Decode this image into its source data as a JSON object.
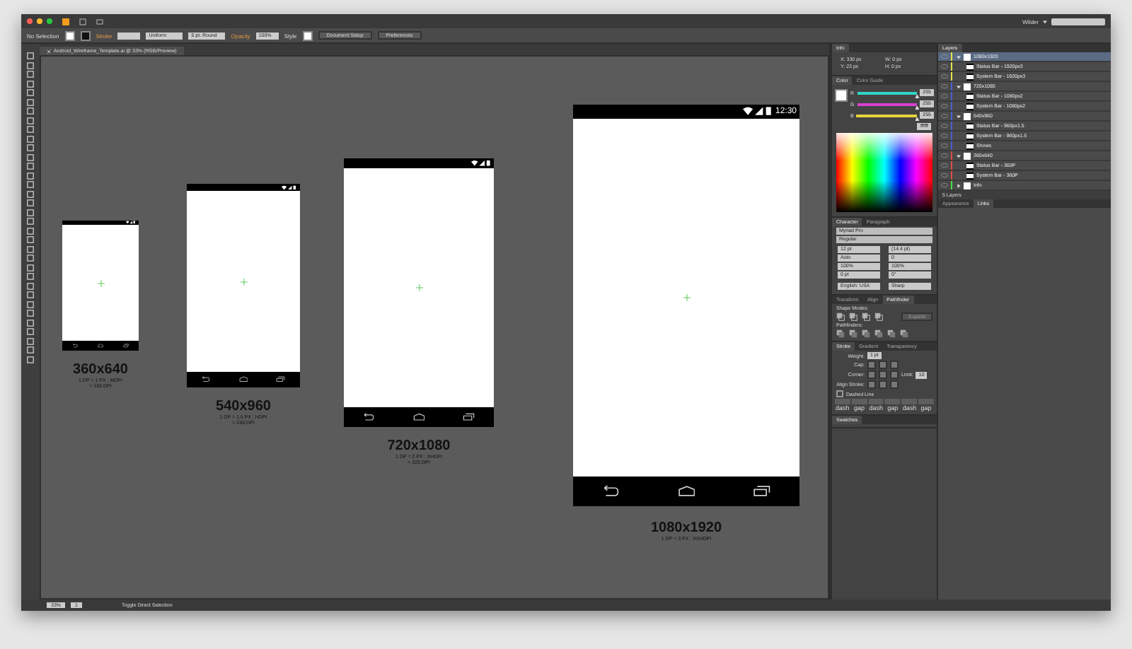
{
  "app_bar": {
    "workspace": "Wilder"
  },
  "control_bar": {
    "selection": "No Selection",
    "stroke_label": "Stroke",
    "stroke_profile": "Uniform",
    "brush": "5 pt. Round",
    "opacity_label": "Opacity",
    "opacity": "100%",
    "style_label": "Style",
    "buttons": [
      "Document Setup",
      "Preferences"
    ]
  },
  "document_tab": {
    "title": "Android_Wireframe_Template.ai @ 33% (RGB/Preview)"
  },
  "artboards": [
    {
      "size": "360x640",
      "lines": [
        "1 DP = 1 PX : MDPI",
        "= 160 DPI"
      ]
    },
    {
      "size": "540x960",
      "lines": [
        "1 DP = 1.5 PX : HDPI",
        "= 240 DPI"
      ]
    },
    {
      "size": "720x1080",
      "lines": [
        "1 DP = 2 PX : XHDPI",
        "= 320 DPI"
      ]
    },
    {
      "size": "1080x1920",
      "lines": [
        "1 DP = 3 PX : XXHDPI"
      ],
      "time": "12:30"
    }
  ],
  "info_panel": {
    "title": "Info",
    "fields": [
      "X: 330 px",
      "W: 0 px",
      "Y: 23 px",
      "H: 0 px"
    ]
  },
  "color_panel": {
    "tabs": [
      {
        "label": "Color",
        "selected": true
      },
      {
        "label": "Color Guide",
        "selected": false
      }
    ],
    "channels": [
      {
        "name": "R",
        "value": "255",
        "color": "#2fd6c8",
        "level": 1
      },
      {
        "name": "G",
        "value": "255",
        "color": "#d63fd0",
        "level": 1
      },
      {
        "name": "B",
        "value": "255",
        "color": "#e4d43a",
        "level": 1
      }
    ],
    "hex": "ffffff"
  },
  "character_panel": {
    "tabs": [
      {
        "label": "Character",
        "selected": true
      },
      {
        "label": "Paragraph",
        "selected": false
      }
    ],
    "font": "Myriad Pro",
    "style": "Regular",
    "fields": [
      "12 pt",
      "(14.4 pt)",
      "Auto",
      "0",
      "100%",
      "100%",
      "0 pt",
      "0°"
    ],
    "language": "English: USA",
    "antialias": "Sharp"
  },
  "pathfinder_panel": {
    "tabs": [
      {
        "label": "Transform",
        "selected": false
      },
      {
        "label": "Align",
        "selected": false
      },
      {
        "label": "Pathfinder",
        "selected": true
      }
    ],
    "shape_modes": "Shape Modes:",
    "expand": "Expand",
    "pathfinders": "Pathfinders:"
  },
  "stroke_panel": {
    "tabs": [
      {
        "label": "Stroke",
        "selected": true
      },
      {
        "label": "Gradient",
        "selected": false
      },
      {
        "label": "Transparency",
        "selected": false
      }
    ],
    "weight_label": "Weight:",
    "weight": "1 pt",
    "cap_label": "Cap:",
    "corner_label": "Corner:",
    "limit_label": "Limit:",
    "limit": "10",
    "align_label": "Align Stroke:",
    "dashed": {
      "label": "Dashed Line",
      "checked": false
    },
    "dash_labels": [
      "dash",
      "gap",
      "dash",
      "gap",
      "dash",
      "gap"
    ]
  },
  "swatches_panel": {
    "title": "Swatches"
  },
  "layers_panel": {
    "title": "Layers",
    "layers": [
      {
        "name": "1080x1920",
        "color": "#e6e24a",
        "expanded": true,
        "selected": true,
        "visible": true,
        "children": [
          {
            "name": "Status Bar - 1920px3",
            "selected": false,
            "visible": true
          },
          {
            "name": "System Bar - 1920px3",
            "selected": false,
            "visible": true
          }
        ]
      },
      {
        "name": "720x1080",
        "color": "#4a5fd6",
        "expanded": true,
        "selected": false,
        "visible": true,
        "children": [
          {
            "name": "Status Bar - 1080px2",
            "selected": false,
            "visible": true
          },
          {
            "name": "System Bar - 1080px2",
            "selected": false,
            "visible": true
          }
        ]
      },
      {
        "name": "540x960",
        "color": "#4a5fd6",
        "expanded": true,
        "selected": false,
        "visible": true,
        "children": [
          {
            "name": "Status Bar - 960px1.5",
            "selected": false,
            "visible": true
          },
          {
            "name": "System Bar - 960px1.5",
            "selected": false,
            "visible": true
          },
          {
            "name": "Shows",
            "selected": false,
            "visible": true
          }
        ]
      },
      {
        "name": "360x640",
        "color": "#e04a4a",
        "expanded": true,
        "selected": false,
        "visible": true,
        "children": [
          {
            "name": "Status Bar - 360P",
            "selected": false,
            "visible": true
          },
          {
            "name": "System Bar - 360P",
            "selected": false,
            "visible": true
          }
        ]
      },
      {
        "name": "Info",
        "color": "#4ae04a",
        "expanded": false,
        "selected": false,
        "visible": true
      }
    ],
    "footer": "5 Layers"
  },
  "appearance_panel": {
    "tabs": [
      {
        "label": "Appearance",
        "selected": false
      },
      {
        "label": "Links",
        "selected": true
      }
    ]
  },
  "status_bar": {
    "zoom": "33%",
    "artboard": "1",
    "tool": "Toggle Direct Selection"
  }
}
